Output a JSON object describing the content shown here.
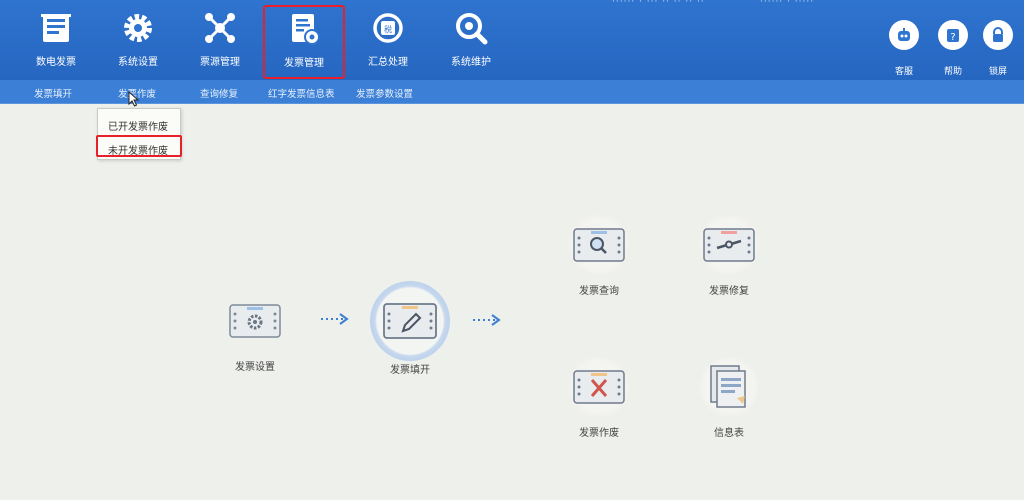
{
  "top_status": {
    "left": "······ · ··· ·· ·· ·· ··",
    "right": "······ · ·····"
  },
  "nav": [
    {
      "id": "digital-invoice",
      "label": "数电发票",
      "icon": "invoice-icon"
    },
    {
      "id": "system-settings",
      "label": "系统设置",
      "icon": "gear-icon"
    },
    {
      "id": "ticket-source",
      "label": "票源管理",
      "icon": "network-icon"
    },
    {
      "id": "invoice-management",
      "label": "发票管理",
      "icon": "invoice-manage-icon",
      "active": true
    },
    {
      "id": "summary-processing",
      "label": "汇总处理",
      "icon": "summary-icon"
    },
    {
      "id": "system-maintenance",
      "label": "系统维护",
      "icon": "search-gear-icon"
    }
  ],
  "right_buttons": [
    {
      "id": "customer-service",
      "label": "客服",
      "icon": "robot-icon"
    },
    {
      "id": "help",
      "label": "帮助",
      "icon": "help-icon"
    },
    {
      "id": "lock-screen",
      "label": "锁屏",
      "icon": "lock-icon"
    }
  ],
  "subnav": [
    {
      "id": "invoice-fill",
      "label": "发票填开"
    },
    {
      "id": "invoice-void",
      "label": "发票作废"
    },
    {
      "id": "query-repair",
      "label": "查询修复"
    },
    {
      "id": "red-info",
      "label": "红字发票信息表"
    },
    {
      "id": "invoice-params",
      "label": "发票参数设置"
    }
  ],
  "dropdown": [
    {
      "id": "void-issued",
      "label": "已开发票作废"
    },
    {
      "id": "void-unissued",
      "label": "未开发票作废",
      "highlighted": true
    }
  ],
  "flow": {
    "settings": {
      "label": "发票设置",
      "icon": "invoice-settings-icon"
    },
    "fill": {
      "label": "发票填开",
      "icon": "invoice-edit-icon"
    },
    "query": {
      "label": "发票查询",
      "icon": "invoice-query-icon"
    },
    "repair": {
      "label": "发票修复",
      "icon": "invoice-repair-icon"
    },
    "void": {
      "label": "发票作废",
      "icon": "invoice-void-icon"
    },
    "info": {
      "label": "信息表",
      "icon": "documents-icon"
    }
  },
  "colors": {
    "topbar": "#2f74cf",
    "subbar": "#3b7fd6",
    "highlight": "#e8202a",
    "background": "#eef0ec"
  }
}
